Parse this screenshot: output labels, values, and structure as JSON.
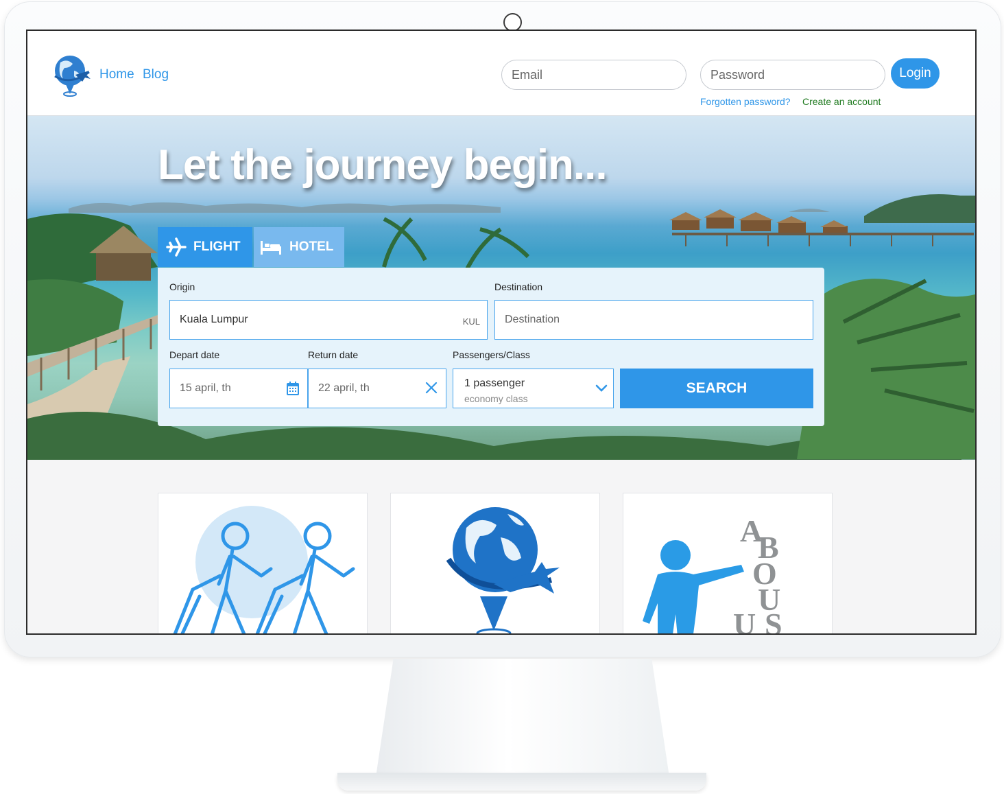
{
  "header": {
    "nav": {
      "home": "Home",
      "blog": "Blog"
    },
    "email_placeholder": "Email",
    "password_placeholder": "Password",
    "login_label": "Login",
    "forgot_password": "Forgotten password?",
    "create_account": "Create an account"
  },
  "hero": {
    "title": "Let the journey begin..."
  },
  "tabs": [
    {
      "label": "FLIGHT",
      "icon": "airplane-icon",
      "active": true
    },
    {
      "label": "HOTEL",
      "icon": "bed-icon",
      "active": false
    }
  ],
  "search": {
    "origin_label": "Origin",
    "origin_value": "Kuala Lumpur",
    "origin_code": "KUL",
    "destination_label": "Destination",
    "destination_placeholder": "Destination",
    "depart_label": "Depart date",
    "depart_value": "15 april, th",
    "return_label": "Return date",
    "return_value": "22 april, th",
    "pax_label": "Passengers/Class",
    "pax_value": "1 passenger",
    "class_value": "economy class",
    "search_label": "SEARCH"
  },
  "cards": [
    {
      "icon": "travelers-icon"
    },
    {
      "icon": "globe-plane-icon"
    },
    {
      "icon": "about-us-icon"
    }
  ],
  "colors": {
    "accent": "#2f96e8",
    "tab_inactive": "#79b9ee",
    "panel_bg": "#e6f3fb",
    "create_account": "#1f7a1f"
  }
}
